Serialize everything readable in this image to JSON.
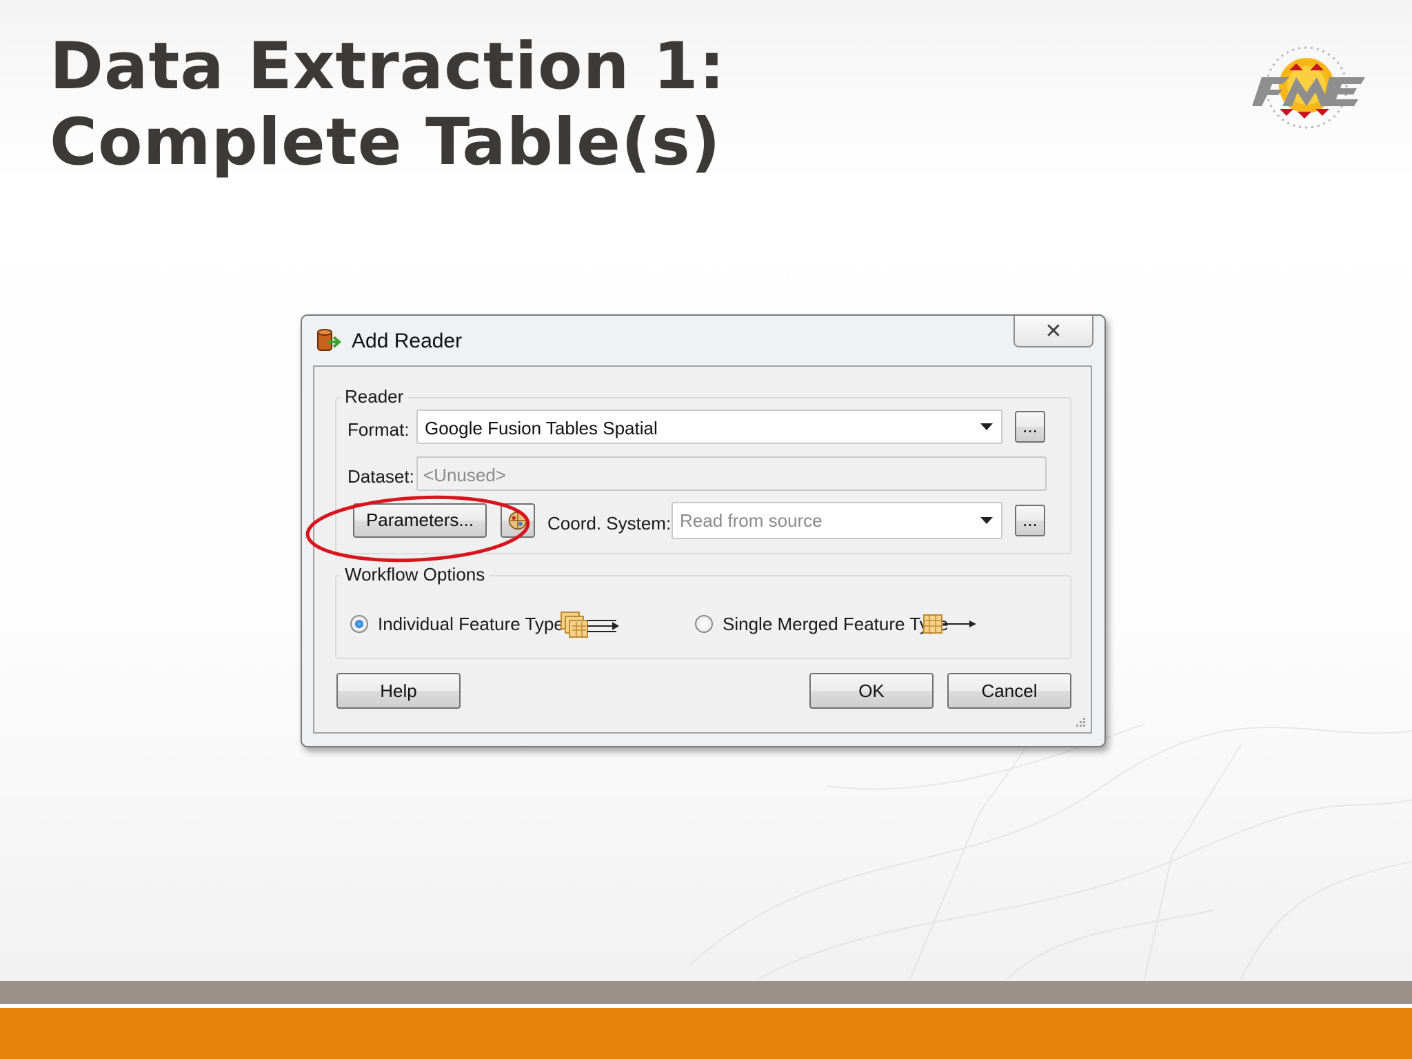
{
  "slide": {
    "title_line1": "Data Extraction 1:",
    "title_line2": "Complete Table(s)",
    "logo_icon": "fme-logo"
  },
  "dialog": {
    "title": "Add Reader",
    "title_icon": "add-reader-icon",
    "close_label": "✕",
    "reader_group": {
      "label": "Reader",
      "format_label": "Format:",
      "format_value": "Google Fusion Tables Spatial",
      "format_browse": "...",
      "dataset_label": "Dataset:",
      "dataset_value": "<Unused>",
      "parameters_button": "Parameters...",
      "coord_label": "Coord. System:",
      "coord_value": "Read from source",
      "coord_browse": "..."
    },
    "workflow_group": {
      "label": "Workflow Options",
      "option_individual": "Individual Feature Types",
      "option_individual_checked": true,
      "option_merged": "Single Merged Feature Type",
      "option_merged_checked": false
    },
    "buttons": {
      "help": "Help",
      "ok": "OK",
      "cancel": "Cancel"
    }
  },
  "colors": {
    "title_text": "#3c3a38",
    "gray_bar": "#9a918a",
    "orange_bar": "#e8830d",
    "highlight_ellipse": "#d8141c"
  }
}
